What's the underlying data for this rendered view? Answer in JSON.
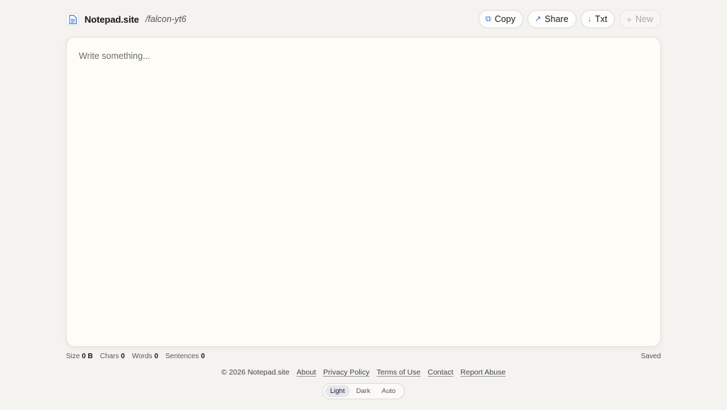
{
  "header": {
    "brand": "Notepad.site",
    "slug": "/falcon-yt6",
    "buttons": {
      "copy": "Copy",
      "share": "Share",
      "txt": "Txt",
      "new": "New"
    }
  },
  "editor": {
    "placeholder": "Write something...",
    "value": ""
  },
  "status": {
    "size_label": "Size",
    "size_value": "0 B",
    "chars_label": "Chars",
    "chars_value": "0",
    "words_label": "Words",
    "words_value": "0",
    "sentences_label": "Sentences",
    "sentences_value": "0",
    "saved": "Saved"
  },
  "footer": {
    "copyright": "© 2026 Notepad.site",
    "links": [
      "About",
      "Privacy Policy",
      "Terms of Use",
      "Contact",
      "Report Abuse"
    ]
  },
  "theme": {
    "options": [
      "Light",
      "Dark",
      "Auto"
    ],
    "selected": "Light"
  },
  "colors": {
    "background": "#f4f3ef",
    "editor_bg": "#fdfcf7",
    "accent": "#3b6fd8"
  },
  "icons": {
    "logo": "document-icon",
    "copy": "copy-icon",
    "share": "arrow-up-right-icon",
    "txt": "arrow-down-icon",
    "new": "plus-icon"
  }
}
